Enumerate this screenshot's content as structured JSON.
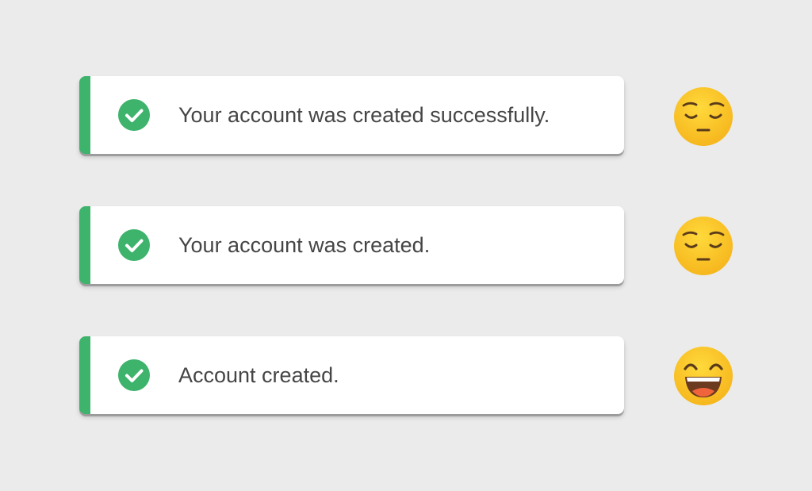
{
  "colors": {
    "background": "#ebebeb",
    "accent": "#3db36b",
    "text": "#454545",
    "emoji_face": "#fbc531"
  },
  "toasts": [
    {
      "icon": "check-circle-icon",
      "message": "Your account was created successfully.",
      "reaction": "pensive-face-emoji"
    },
    {
      "icon": "check-circle-icon",
      "message": "Your account was created.",
      "reaction": "pensive-face-emoji"
    },
    {
      "icon": "check-circle-icon",
      "message": "Account created.",
      "reaction": "grinning-squinting-face-emoji"
    }
  ]
}
